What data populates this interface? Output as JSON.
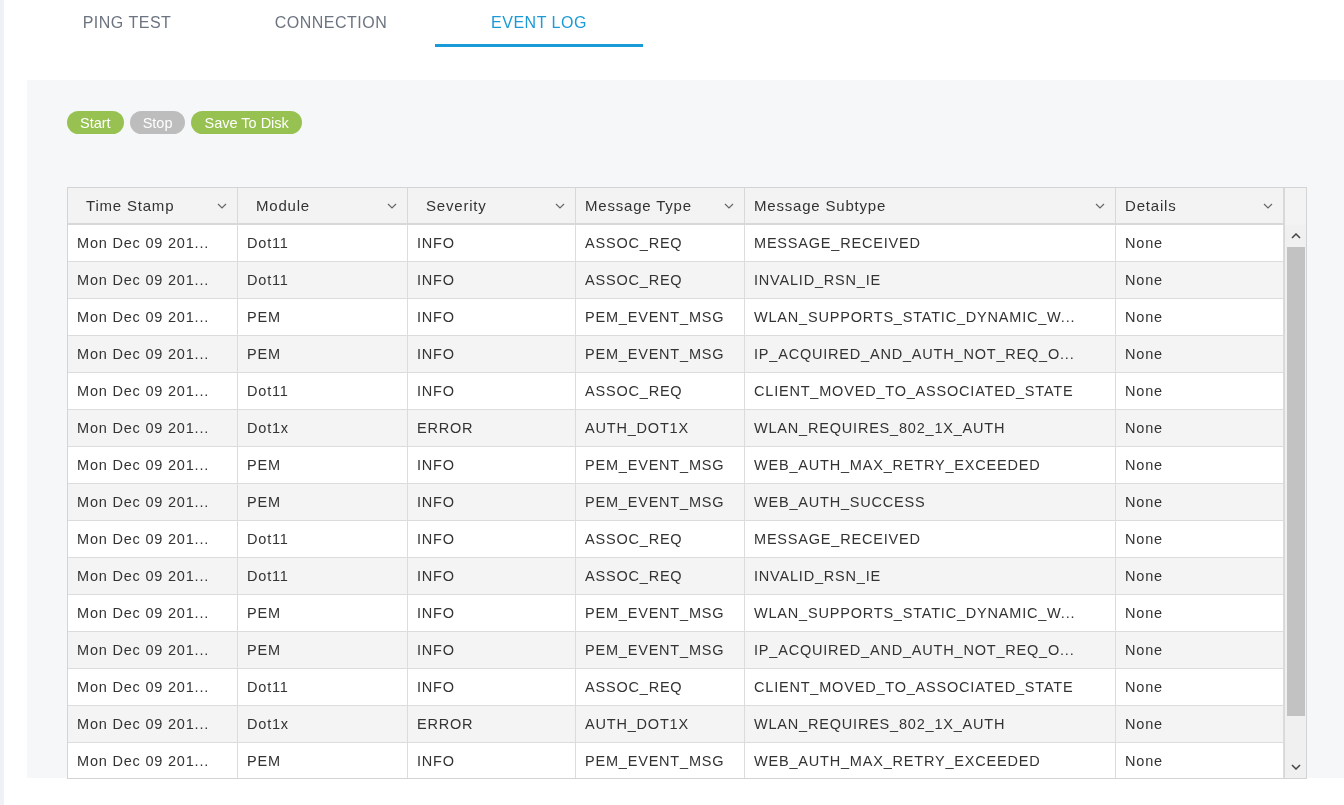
{
  "tabs": [
    {
      "label": "PING TEST",
      "selected": false
    },
    {
      "label": "CONNECTION",
      "selected": false
    },
    {
      "label": "EVENT LOG",
      "selected": true
    }
  ],
  "buttons": [
    {
      "label": "Start",
      "disabled": false
    },
    {
      "label": "Stop",
      "disabled": true
    },
    {
      "label": "Save To Disk",
      "disabled": false
    }
  ],
  "table": {
    "columns": [
      "Time Stamp",
      "Module",
      "Severity",
      "Message Type",
      "Message Subtype",
      "Details"
    ],
    "rows": [
      [
        "Mon Dec 09 201...",
        "Dot11",
        "INFO",
        "ASSOC_REQ",
        "MESSAGE_RECEIVED",
        "None"
      ],
      [
        "Mon Dec 09 201...",
        "Dot11",
        "INFO",
        "ASSOC_REQ",
        "INVALID_RSN_IE",
        "None"
      ],
      [
        "Mon Dec 09 201...",
        "PEM",
        "INFO",
        "PEM_EVENT_MSG",
        "WLAN_SUPPORTS_STATIC_DYNAMIC_W...",
        "None"
      ],
      [
        "Mon Dec 09 201...",
        "PEM",
        "INFO",
        "PEM_EVENT_MSG",
        "IP_ACQUIRED_AND_AUTH_NOT_REQ_O...",
        "None"
      ],
      [
        "Mon Dec 09 201...",
        "Dot11",
        "INFO",
        "ASSOC_REQ",
        "CLIENT_MOVED_TO_ASSOCIATED_STATE",
        "None"
      ],
      [
        "Mon Dec 09 201...",
        "Dot1x",
        "ERROR",
        "AUTH_DOT1X",
        "WLAN_REQUIRES_802_1X_AUTH",
        "None"
      ],
      [
        "Mon Dec 09 201...",
        "PEM",
        "INFO",
        "PEM_EVENT_MSG",
        "WEB_AUTH_MAX_RETRY_EXCEEDED",
        "None"
      ],
      [
        "Mon Dec 09 201...",
        "PEM",
        "INFO",
        "PEM_EVENT_MSG",
        "WEB_AUTH_SUCCESS",
        "None"
      ],
      [
        "Mon Dec 09 201...",
        "Dot11",
        "INFO",
        "ASSOC_REQ",
        "MESSAGE_RECEIVED",
        "None"
      ],
      [
        "Mon Dec 09 201...",
        "Dot11",
        "INFO",
        "ASSOC_REQ",
        "INVALID_RSN_IE",
        "None"
      ],
      [
        "Mon Dec 09 201...",
        "PEM",
        "INFO",
        "PEM_EVENT_MSG",
        "WLAN_SUPPORTS_STATIC_DYNAMIC_W...",
        "None"
      ],
      [
        "Mon Dec 09 201...",
        "PEM",
        "INFO",
        "PEM_EVENT_MSG",
        "IP_ACQUIRED_AND_AUTH_NOT_REQ_O...",
        "None"
      ],
      [
        "Mon Dec 09 201...",
        "Dot11",
        "INFO",
        "ASSOC_REQ",
        "CLIENT_MOVED_TO_ASSOCIATED_STATE",
        "None"
      ],
      [
        "Mon Dec 09 201...",
        "Dot1x",
        "ERROR",
        "AUTH_DOT1X",
        "WLAN_REQUIRES_802_1X_AUTH",
        "None"
      ],
      [
        "Mon Dec 09 201...",
        "PEM",
        "INFO",
        "PEM_EVENT_MSG",
        "WEB_AUTH_MAX_RETRY_EXCEEDED",
        "None"
      ]
    ]
  }
}
